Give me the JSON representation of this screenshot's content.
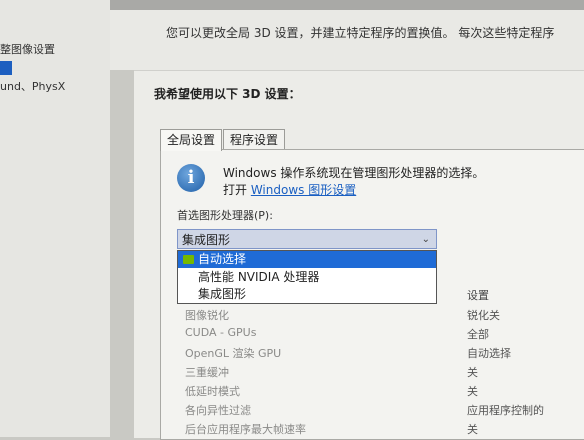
{
  "left_panel": {
    "items": [
      {
        "label": "整图像设置"
      },
      {
        "label": "置"
      },
      {
        "label": "und、PhysX"
      }
    ]
  },
  "header": {
    "description": "您可以更改全局 3D 设置，并建立特定程序的置换值。 每次这些特定程序"
  },
  "panel": {
    "title": "我希望使用以下 3D 设置：",
    "tabs": [
      {
        "label": "全局设置"
      },
      {
        "label": "程序设置"
      }
    ],
    "info": {
      "line1": "Windows 操作系统现在管理图形处理器的选择。",
      "line2_prefix": "打开 ",
      "link": "Windows 图形设置"
    },
    "preferred_gpu_label": "首选图形处理器(P):",
    "preferred_gpu_value": "集成图形",
    "dropdown_options": [
      {
        "label": "自动选择",
        "selected": true
      },
      {
        "label": "高性能 NVIDIA 处理器",
        "selected": false
      },
      {
        "label": "集成图形",
        "selected": false
      }
    ],
    "settings_header": "设置",
    "settings_rows": [
      {
        "feature": "图像锐化",
        "value": "锐化关"
      },
      {
        "feature": "CUDA - GPUs",
        "value": "全部"
      },
      {
        "feature": "OpenGL 渲染 GPU",
        "value": "自动选择"
      },
      {
        "feature": "三重缓冲",
        "value": "关"
      },
      {
        "feature": "低延时模式",
        "value": "关"
      },
      {
        "feature": "各向异性过滤",
        "value": "应用程序控制的"
      },
      {
        "feature": "后台应用程序最大帧速率",
        "value": "关"
      }
    ]
  },
  "colors": {
    "accent": "#1f6bd6",
    "nvidia_green": "#76b900",
    "link": "#1a5fc2"
  },
  "icons": {
    "info": "info-icon",
    "dropdown_arrow": "chevron-down-icon",
    "nvidia": "nvidia-chip-icon"
  }
}
